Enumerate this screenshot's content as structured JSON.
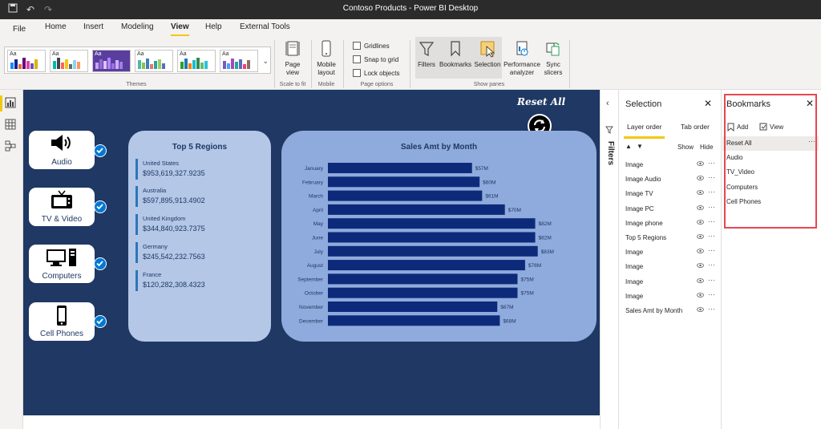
{
  "window": {
    "title": "Contoso Products - Power BI Desktop"
  },
  "tabs": [
    {
      "label": "File"
    },
    {
      "label": "Home"
    },
    {
      "label": "Insert"
    },
    {
      "label": "Modeling"
    },
    {
      "label": "View"
    },
    {
      "label": "Help"
    },
    {
      "label": "External Tools"
    }
  ],
  "ribbon": {
    "themes_label": "Themes",
    "scale_label": "Scale to fit",
    "mobile_label": "Mobile",
    "page_options_label": "Page options",
    "show_panes_label": "Show panes",
    "page_view": "Page view",
    "mobile_layout": "Mobile layout",
    "gridlines": "Gridlines",
    "snap_to_grid": "Snap to grid",
    "lock_objects": "Lock objects",
    "filters": "Filters",
    "bookmarks": "Bookmarks",
    "selection": "Selection",
    "performance_analyzer": "Performance analyzer",
    "sync_slicers": "Sync slicers",
    "theme_aa": "Aa"
  },
  "report": {
    "reset_all": "Reset All",
    "categories": [
      {
        "label": "Audio",
        "icon": "speaker-icon"
      },
      {
        "label": "TV & Video",
        "icon": "tv-icon"
      },
      {
        "label": "Computers",
        "icon": "computer-icon"
      },
      {
        "label": "Cell Phones",
        "icon": "cell-phone-icon"
      }
    ],
    "top_regions": {
      "title": "Top 5 Regions",
      "items": [
        {
          "name": "United States",
          "value": "$953,619,327.9235"
        },
        {
          "name": "Australia",
          "value": "$597,895,913.4902"
        },
        {
          "name": "United Kingdom",
          "value": "$344,840,923.7375"
        },
        {
          "name": "Germany",
          "value": "$245,542,232.7563"
        },
        {
          "name": "France",
          "value": "$120,282,308.4323"
        }
      ]
    }
  },
  "chart_data": {
    "type": "bar",
    "title": "Sales Amt by Month",
    "categories": [
      "January",
      "February",
      "March",
      "April",
      "May",
      "June",
      "July",
      "August",
      "September",
      "October",
      "November",
      "December"
    ],
    "values": [
      57,
      60,
      61,
      70,
      82,
      82,
      83,
      78,
      75,
      75,
      67,
      68
    ],
    "data_labels": [
      "$57M",
      "$60M",
      "$61M",
      "$70M",
      "$82M",
      "$82M",
      "$83M",
      "$78M",
      "$75M",
      "$75M",
      "$67M",
      "$68M"
    ],
    "bar_color": "#0d2a7a",
    "orientation": "horizontal"
  },
  "filters_pane": {
    "label": "Filters"
  },
  "selection_pane": {
    "title": "Selection",
    "tab_layer": "Layer order",
    "tab_order": "Tab order",
    "show": "Show",
    "hide": "Hide",
    "layers": [
      "Image",
      "Image Audio",
      "Image TV",
      "Image PC",
      "Image phone",
      "Top 5 Regions",
      "Image",
      "Image",
      "Image",
      "Image",
      "Sales Amt by Month"
    ]
  },
  "bookmarks_pane": {
    "title": "Bookmarks",
    "add": "Add",
    "view": "View",
    "items": [
      "Reset All",
      "Audio",
      "TV_Video",
      "Computers",
      "Cell Phones"
    ],
    "selected": "Reset All"
  },
  "colors": {
    "canvas": "#1f3864",
    "accent": "#f2c811",
    "highlight_outline": "#e8474f"
  }
}
